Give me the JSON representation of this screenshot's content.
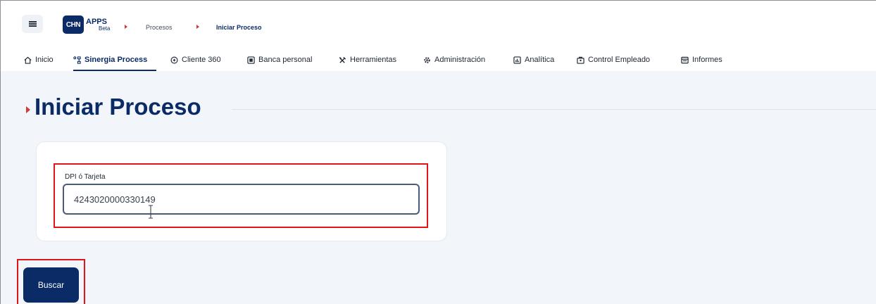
{
  "header": {
    "logo_mark": "CHN",
    "logo_apps": "APPS",
    "logo_beta": "Beta",
    "breadcrumb": [
      "Procesos",
      "Iniciar Proceso"
    ]
  },
  "nav": {
    "items": [
      {
        "label": "Inicio",
        "icon": "home-icon"
      },
      {
        "label": "Sinergia Process",
        "icon": "process-icon",
        "active": true
      },
      {
        "label": "Cliente 360",
        "icon": "cliente-icon"
      },
      {
        "label": "Banca personal",
        "icon": "bank-icon"
      },
      {
        "label": "Herramientas",
        "icon": "tools-icon"
      },
      {
        "label": "Administración",
        "icon": "gear-icon"
      },
      {
        "label": "Analítica",
        "icon": "chart-icon"
      },
      {
        "label": "Control Empleado",
        "icon": "employee-icon"
      },
      {
        "label": "Informes",
        "icon": "report-icon"
      }
    ]
  },
  "page": {
    "title": "Iniciar Proceso"
  },
  "form": {
    "field_label": "DPI ó Tarjeta",
    "field_value": "4243020000330149"
  },
  "actions": {
    "search_label": "Buscar"
  },
  "colors": {
    "brand": "#0b2b66",
    "accent": "#d23a3a",
    "highlight": "#e0151b"
  }
}
